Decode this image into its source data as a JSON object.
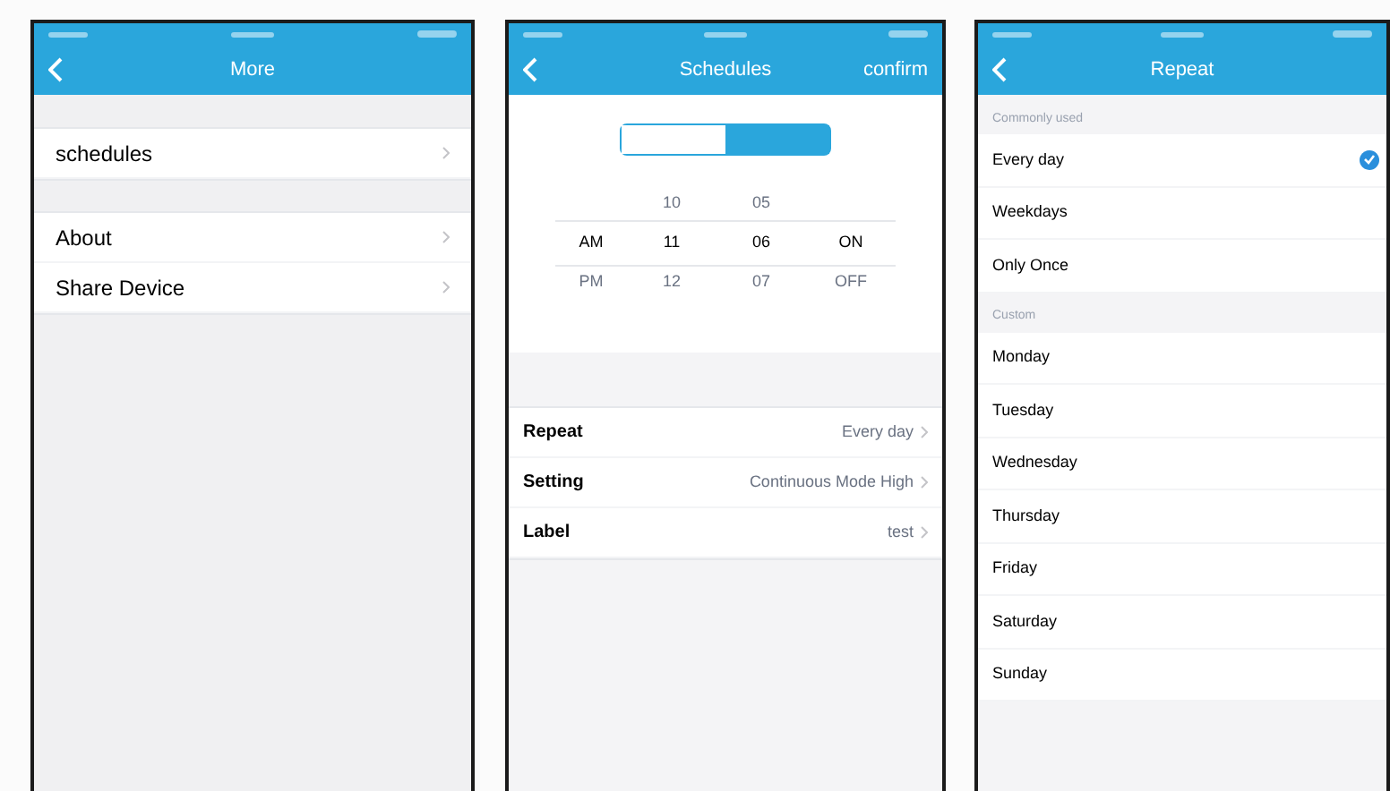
{
  "screens": [
    {
      "kind": "menu",
      "title": "More",
      "groups": [
        [
          {
            "label": "schedules"
          }
        ],
        [
          {
            "label": "About"
          },
          {
            "label": "Share Device"
          }
        ]
      ]
    },
    {
      "kind": "schedule",
      "title": "Schedules",
      "action": "confirm",
      "segments": [
        {
          "selected": false
        },
        {
          "selected": true
        }
      ],
      "picker": {
        "above": [
          "10",
          "05"
        ],
        "current": [
          "AM",
          "11",
          "06",
          "ON"
        ],
        "below": [
          "PM",
          "12",
          "07",
          "OFF"
        ]
      },
      "settings": [
        {
          "label": "Repeat",
          "value": "Every day"
        },
        {
          "label": "Setting",
          "value": "Continuous Mode High"
        },
        {
          "label": "Label",
          "value": "test"
        }
      ]
    },
    {
      "kind": "repeat",
      "title": "Repeat",
      "sections": [
        {
          "header": "Commonly used",
          "options": [
            {
              "label": "Every day",
              "selected": true
            },
            {
              "label": "Weekdays",
              "selected": false
            },
            {
              "label": "Only Once",
              "selected": false
            }
          ]
        },
        {
          "header": "Custom",
          "options": [
            {
              "label": "Monday",
              "selected": false
            },
            {
              "label": "Tuesday",
              "selected": false
            },
            {
              "label": "Wednesday",
              "selected": false
            },
            {
              "label": "Thursday",
              "selected": false
            },
            {
              "label": "Friday",
              "selected": false
            },
            {
              "label": "Saturday",
              "selected": false
            },
            {
              "label": "Sunday",
              "selected": false
            }
          ]
        }
      ]
    }
  ]
}
